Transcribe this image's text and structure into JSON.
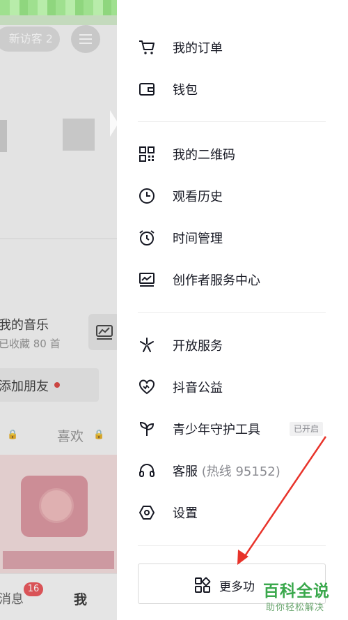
{
  "left_page": {
    "visitor_label": "新访客 2",
    "music_title": "我的音乐",
    "music_sub": "已收藏 80 首",
    "add_friend": "添加朋友",
    "likes_tab": "喜欢",
    "tabbar": {
      "messages": "消息",
      "messages_badge": "16",
      "me": "我"
    }
  },
  "drawer": {
    "group1": [
      {
        "label": "我的订单",
        "icon": "cart-icon"
      },
      {
        "label": "钱包",
        "icon": "wallet-icon"
      }
    ],
    "group2": [
      {
        "label": "我的二维码",
        "icon": "qrcode-icon"
      },
      {
        "label": "观看历史",
        "icon": "clock-icon"
      },
      {
        "label": "时间管理",
        "icon": "alarm-icon"
      },
      {
        "label": "创作者服务中心",
        "icon": "creator-monitor-icon"
      }
    ],
    "group3": [
      {
        "label": "开放服务",
        "icon": "open-service-icon"
      },
      {
        "label": "抖音公益",
        "icon": "charity-heart-icon"
      },
      {
        "label": "青少年守护工具",
        "icon": "sprout-icon",
        "tag": "已开启"
      },
      {
        "label": "客服",
        "sub": "(热线 95152)",
        "icon": "headset-icon"
      },
      {
        "label": "设置",
        "icon": "settings-hexagon-icon"
      }
    ],
    "more_button": "更多功",
    "colors": {
      "accent_red": "#e8332a",
      "text": "#161823",
      "secondary": "#8a8b91"
    }
  },
  "watermark": {
    "title": "百科全说",
    "subtitle": "助你轻松解决"
  }
}
